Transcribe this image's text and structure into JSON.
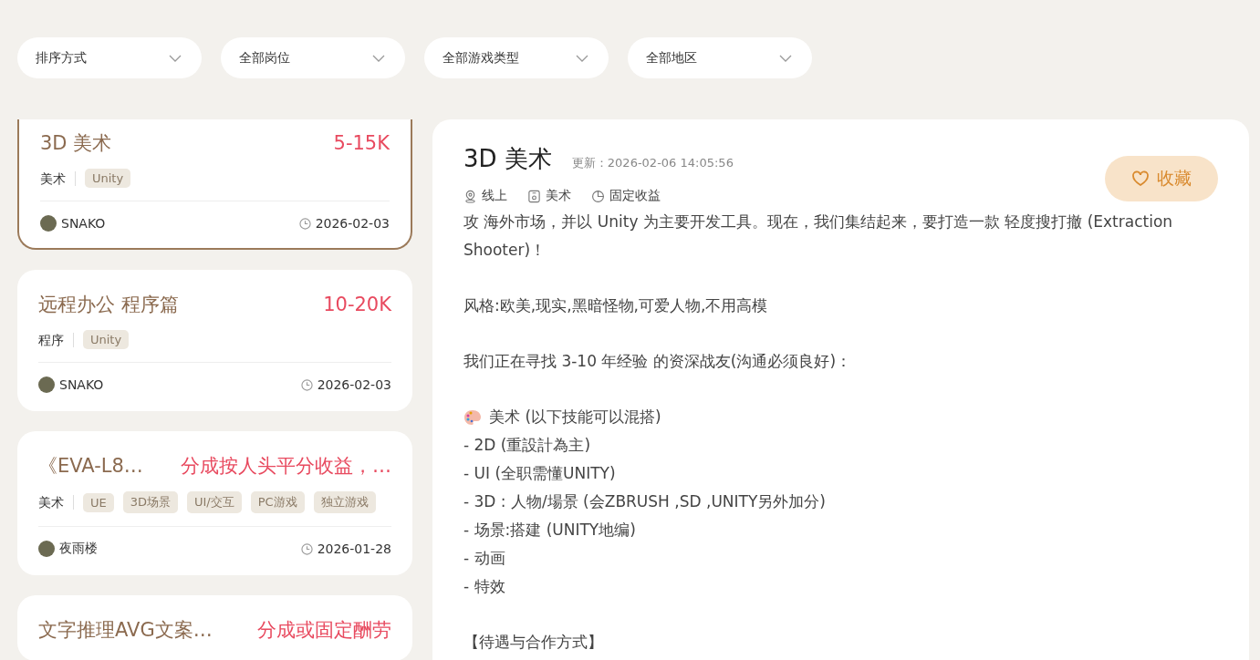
{
  "filters": [
    {
      "label": "排序方式"
    },
    {
      "label": "全部岗位"
    },
    {
      "label": "全部游戏类型"
    },
    {
      "label": "全部地区"
    }
  ],
  "jobs": [
    {
      "title": "3D 美术",
      "salary": "5-15K",
      "category": "美术",
      "tags": [
        "Unity"
      ],
      "author": "SNAKO",
      "date": "2026-02-03",
      "selected": true
    },
    {
      "title": "远程办公 程序篇",
      "salary": "10-20K",
      "category": "程序",
      "tags": [
        "Unity"
      ],
      "author": "SNAKO",
      "date": "2026-02-03",
      "selected": false
    },
    {
      "title": "《EVA-L8…",
      "salary": "分成按人头平分收益，…",
      "category": "美术",
      "tags": [
        "UE",
        "3D场景",
        "UI/交互",
        "PC游戏",
        "独立游戏"
      ],
      "author": "夜雨楼",
      "date": "2026-01-28",
      "selected": false
    },
    {
      "title": "文字推理AVG文案…",
      "salary": "分成或固定酬劳",
      "selected": false
    }
  ],
  "detail": {
    "title": "3D 美术",
    "updated": "更新：2026-02-06 14:05:56",
    "meta": [
      {
        "kind": "location",
        "text": "线上"
      },
      {
        "kind": "category",
        "text": "美术"
      },
      {
        "kind": "pay",
        "text": "固定收益"
      }
    ],
    "favorite_button": {
      "label": "收藏"
    },
    "blocks": [
      {
        "lines": [
          {
            "text": "攻 海外市场，并以 Unity 为主要开发工具。现在，我们集结起来，要打造一款 轻度搜打撤 (Extraction Shooter)！"
          }
        ]
      },
      {
        "lines": [
          {
            "text": "风格:欧美,现实,黑暗怪物,可爱人物,不用高模"
          }
        ]
      },
      {
        "lines": [
          {
            "text": "我们正在寻找 3-10 年经验 的资深战友(沟通必须良好)："
          }
        ]
      },
      {
        "lines": [
          {
            "kind": "palette",
            "text": "美术 (以下技能可以混搭)"
          },
          {
            "text": "- 2D (重設計為主)"
          },
          {
            "text": "- UI (全职需懂UNITY)"
          },
          {
            "text": "- 3D : 人物/場景 (会ZBRUSH ,SD ,UNITY另外加分)"
          },
          {
            "text": "- 场景:搭建 (UNITY地编)"
          },
          {
            "text": "- 动画"
          },
          {
            "text": "- 特效"
          }
        ]
      },
      {
        "lines": [
          {
            "text": "【待遇与合作方式】"
          }
        ]
      }
    ]
  }
}
